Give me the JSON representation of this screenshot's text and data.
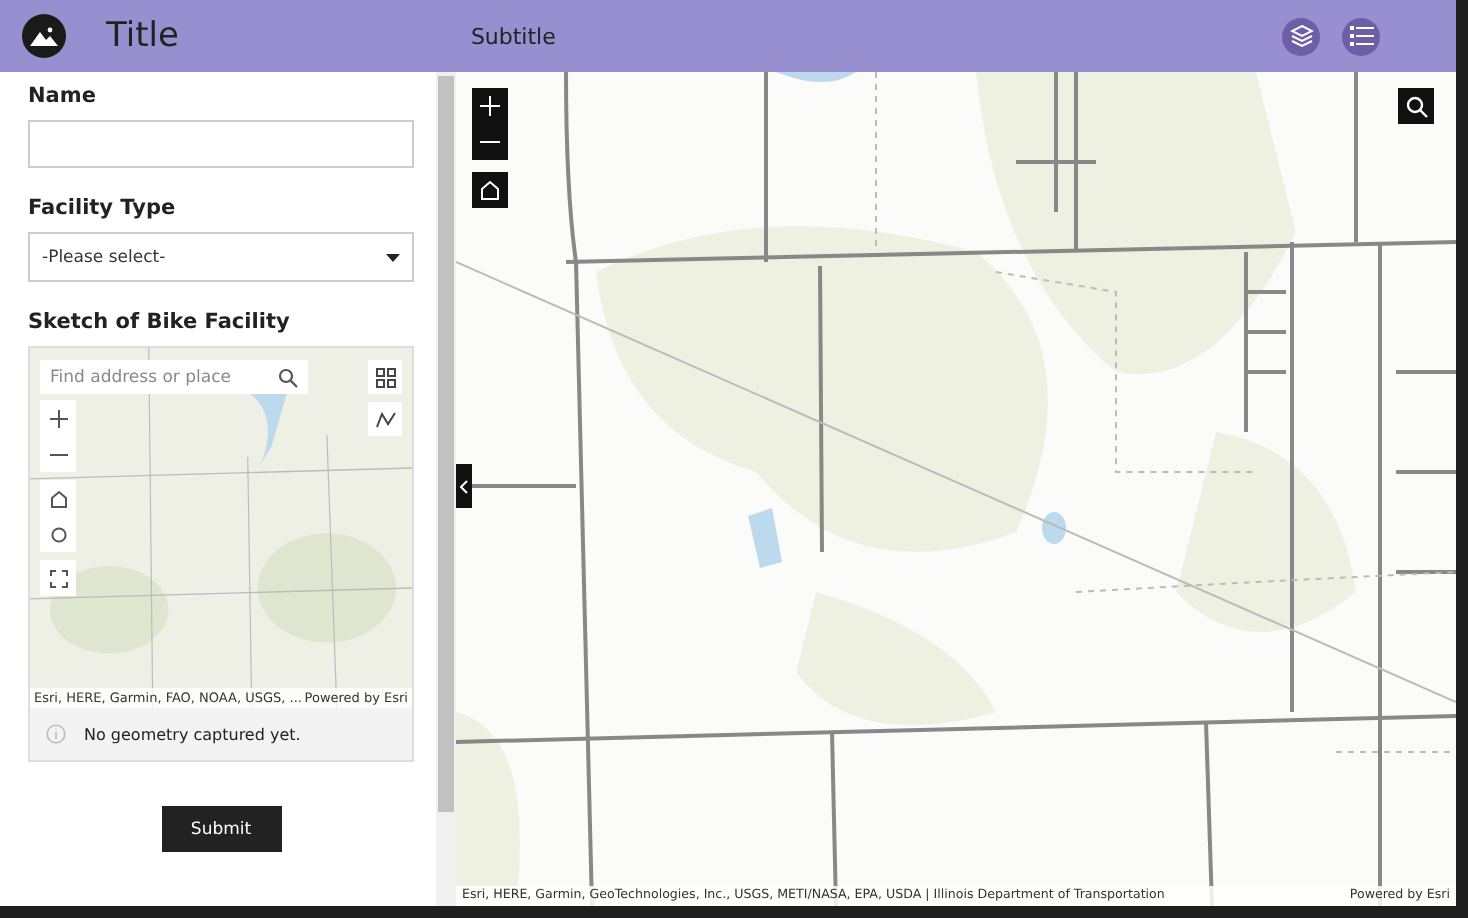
{
  "header": {
    "title": "Title",
    "subtitle": "Subtitle"
  },
  "form": {
    "fields": [
      {
        "kind": "text",
        "label": "Name"
      },
      {
        "kind": "select",
        "label": "Facility Type",
        "value": "-Please select-"
      },
      {
        "kind": "sketch",
        "label": "Sketch of Bike Facility",
        "search_placeholder": "Find address or place",
        "attribution": "Esri, HERE, Garmin, FAO, NOAA, USGS, ...",
        "powered_by": "Powered by Esri",
        "status": "No geometry captured yet."
      }
    ],
    "submit": "Submit"
  },
  "map": {
    "attribution": "Esri, HERE, Garmin, GeoTechnologies, Inc., USGS, METI/NASA, EPA, USDA | Illinois Department of Transportation",
    "powered_by": "Powered by Esri"
  }
}
